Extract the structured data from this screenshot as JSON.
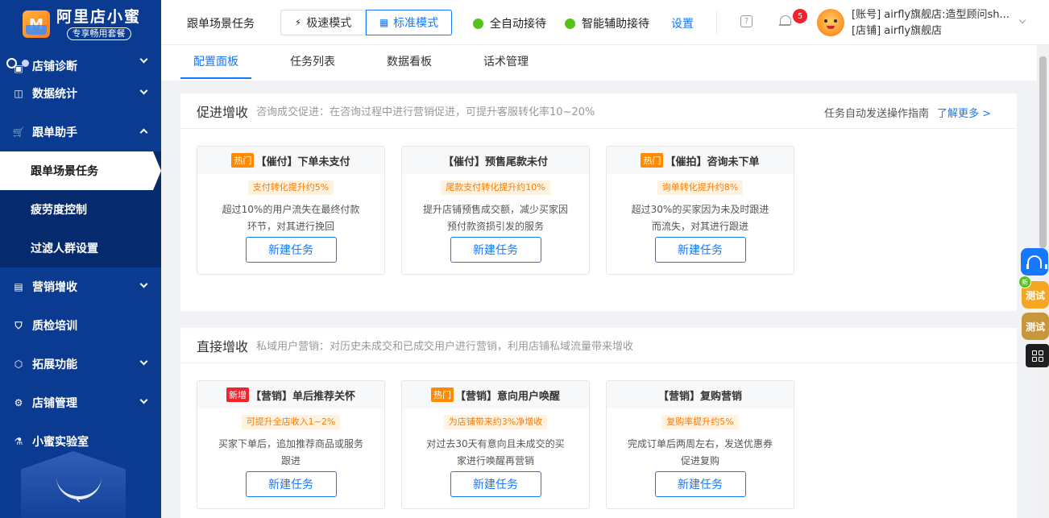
{
  "sidebar": {
    "logo_title": "阿里店小蜜",
    "logo_badge": "专享畅用套餐",
    "items": [
      {
        "label": "店铺诊断",
        "icon": "diagnosis-icon"
      },
      {
        "label": "数据统计",
        "icon": "chart-icon"
      },
      {
        "label": "跟单助手",
        "icon": "cart-icon"
      },
      {
        "label": "营销增收",
        "icon": "wallet-icon"
      },
      {
        "label": "质检培训",
        "icon": "shield-check-icon"
      },
      {
        "label": "拓展功能",
        "icon": "cube-icon"
      },
      {
        "label": "店铺管理",
        "icon": "gear-icon"
      },
      {
        "label": "小蜜实验室",
        "icon": "flask-icon"
      }
    ],
    "sub_items": [
      {
        "label": "跟单场景任务"
      },
      {
        "label": "疲劳度控制"
      },
      {
        "label": "过滤人群设置"
      }
    ],
    "collapse_glyph": "‹"
  },
  "header": {
    "title": "跟单场景任务",
    "mode_fast": "极速模式",
    "mode_standard": "标准模式",
    "status_auto": "全自动接待",
    "status_assist": "智能辅助接待",
    "settings": "设置",
    "bell_count": "5",
    "account_line1": "[账号] airfly旗舰店:造型顾问sh...",
    "account_line2": "[店铺] airfly旗舰店"
  },
  "tabs": [
    {
      "label": "配置面板"
    },
    {
      "label": "任务列表"
    },
    {
      "label": "数据看板"
    },
    {
      "label": "话术管理"
    }
  ],
  "sections": [
    {
      "title": "促进增收",
      "desc": "咨询成交促进：在咨询过程中进行营销促进，可提升客服转化率10~20%",
      "right_text": "任务自动发送操作指南",
      "right_link": "了解更多 >",
      "cards": [
        {
          "tag": "热门",
          "title": "【催付】下单未支付",
          "pill": "支付转化提升约5%",
          "desc": "超过10%的用户流失在最终付款环节，对其进行挽回",
          "button": "新建任务"
        },
        {
          "tag": "",
          "title": "【催付】预售尾款未付",
          "pill": "尾款支付转化提升约10%",
          "desc": "提升店铺预售成交额，减少买家因预付款资损引发的服务",
          "button": "新建任务"
        },
        {
          "tag": "热门",
          "title": "【催拍】咨询未下单",
          "pill": "询单转化提升约8%",
          "desc": "超过30%的买家因为未及时跟进而流失，对其进行跟进",
          "button": "新建任务"
        }
      ]
    },
    {
      "title": "直接增收",
      "desc": "私域用户营销：对历史未成交和已成交用户进行营销，利用店铺私域流量带来增收",
      "cards": [
        {
          "tag": "新增",
          "title": "【营销】单后推荐关怀",
          "pill": "可提升全店收入1~2%",
          "desc": "买家下单后，追加推荐商品或服务跟进",
          "button": "新建任务"
        },
        {
          "tag": "热门",
          "title": "【营销】意向用户唤醒",
          "pill": "为店铺带来约3%净增收",
          "desc": "对过去30天有意向且未成交的买家进行唤醒再营销",
          "button": "新建任务"
        },
        {
          "tag": "",
          "title": "【营销】复购营销",
          "pill": "复购率提升约5%",
          "desc": "完成订单后两周左右，发送优惠券促进复购",
          "button": "新建任务"
        }
      ]
    }
  ],
  "floats": {
    "new_badge": "新",
    "test_a": "测试",
    "test_b": "测试"
  },
  "colors": {
    "sidebar_bg": "#0b3a91",
    "accent": "#1677ff",
    "hot_tag": "#ff8a00",
    "new_tag": "#f5222d",
    "status_green": "#52c41a"
  }
}
